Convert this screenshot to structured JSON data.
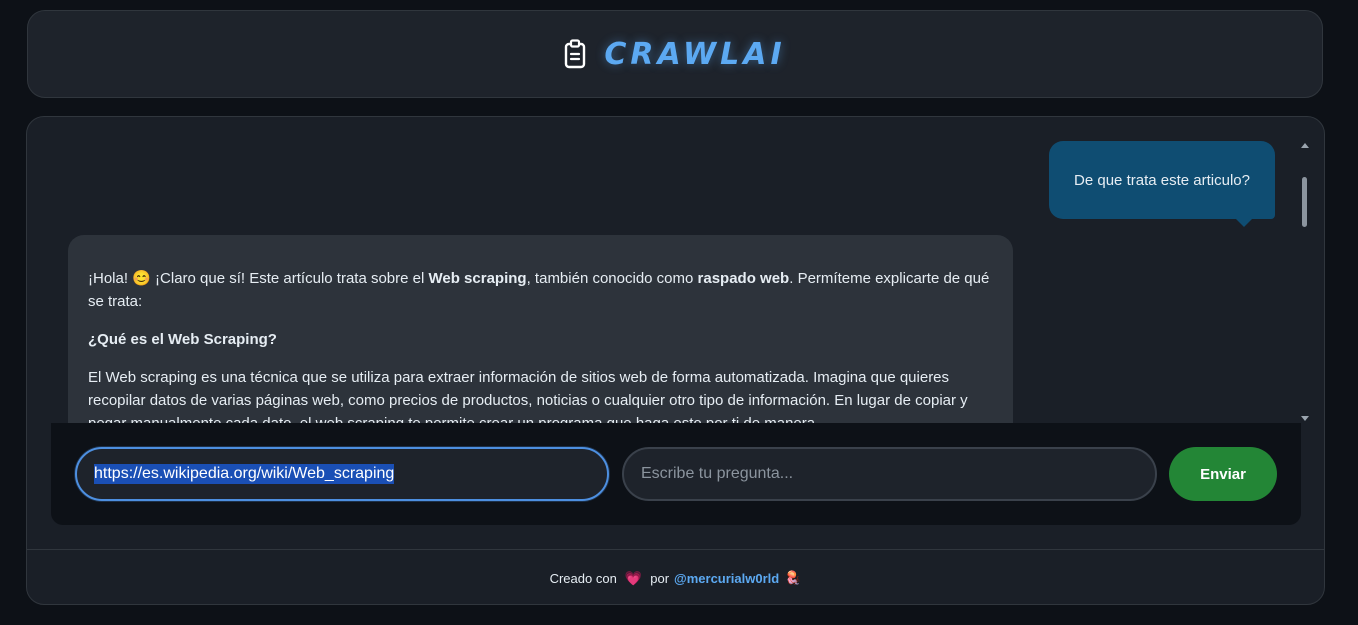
{
  "header": {
    "title": "CRAWLAI",
    "icon": "clipboard-icon"
  },
  "chat": {
    "user_message": "De que trata este articulo?",
    "bot_message": {
      "p1_prefix": "¡Hola! ",
      "p1_emoji": "😊",
      "p1_text_a": " ¡Claro que sí! Este artículo trata sobre el ",
      "p1_bold_a": "Web scraping",
      "p1_text_b": ", también conocido como ",
      "p1_bold_b": "raspado web",
      "p1_text_c": ". Permíteme explicarte de qué se trata:",
      "heading": "¿Qué es el Web Scraping?",
      "p2": "El Web scraping es una técnica que se utiliza para extraer información de sitios web de forma automatizada. Imagina que quieres recopilar datos de varias páginas web, como precios de productos, noticias o cualquier otro tipo de información. En lugar de copiar y pegar manualmente cada dato, el web scraping te permite crear un programa que haga esto por ti de manera"
    }
  },
  "input_bar": {
    "url_value": "https://es.wikipedia.org/wiki/Web_scraping",
    "question_placeholder": "Escribe tu pregunta...",
    "send_label": "Enviar"
  },
  "footer": {
    "prefix": "Creado con",
    "heart": "💗",
    "by": "por",
    "handle": "@mercurialw0rld",
    "emoji": "🪼"
  },
  "colors": {
    "accent": "#5ca9f2",
    "send_button": "#238636",
    "user_bubble": "#0f4d72",
    "bot_bubble": "#2d333b"
  }
}
